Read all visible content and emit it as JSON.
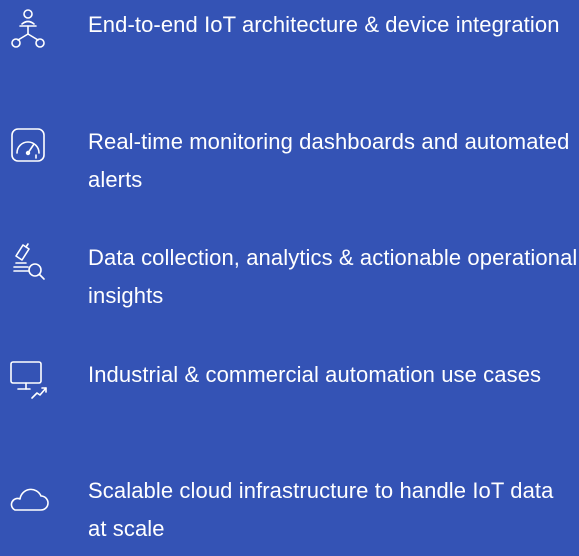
{
  "colors": {
    "background": "#3453b5",
    "text": "#ffffff",
    "icon_stroke": "#ffffff"
  },
  "features": [
    {
      "icon": "network-nodes-icon",
      "text": "End-to-end IoT architecture & device integration"
    },
    {
      "icon": "gauge-icon",
      "text": "Real-time monitoring dashboards and automated alerts"
    },
    {
      "icon": "microscope-search-icon",
      "text": "Data collection, analytics & actionable operational insights"
    },
    {
      "icon": "monitor-trend-icon",
      "text": "Industrial & commercial automation use cases"
    },
    {
      "icon": "cloud-icon",
      "text": "Scalable cloud infrastructure to handle IoT data at scale"
    }
  ]
}
